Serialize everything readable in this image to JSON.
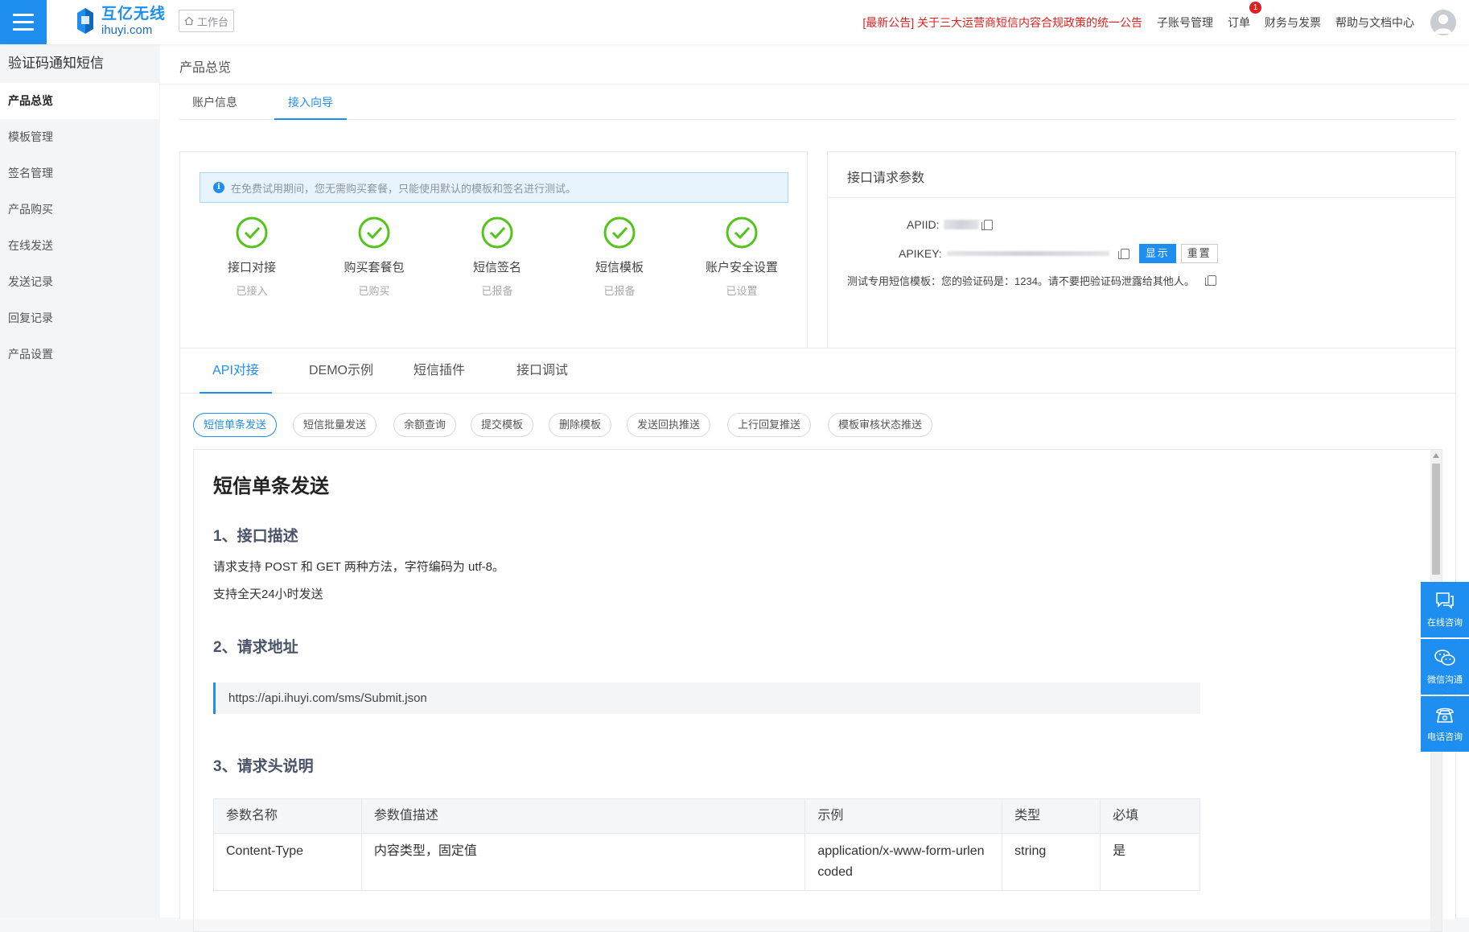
{
  "topbar": {
    "logo_cn": "互亿无线",
    "logo_en": "ihuyi.com",
    "workbench": "工作台",
    "notice": "[最新公告] 关于三大运营商短信内容合规政策的统一公告",
    "links": {
      "sub_account": "子账号管理",
      "orders": "订单",
      "orders_badge": "1",
      "finance": "财务与发票",
      "help": "帮助与文档中心"
    }
  },
  "sidebar": {
    "title": "验证码通知短信",
    "items": [
      {
        "label": "产品总览",
        "active": true
      },
      {
        "label": "模板管理"
      },
      {
        "label": "签名管理"
      },
      {
        "label": "产品购买"
      },
      {
        "label": "在线发送"
      },
      {
        "label": "发送记录"
      },
      {
        "label": "回复记录"
      },
      {
        "label": "产品设置"
      }
    ]
  },
  "main": {
    "breadcrumb": "产品总览",
    "subtabs": [
      "账户信息",
      "接入向导"
    ],
    "active_subtab": "接入向导"
  },
  "status_card": {
    "info": "在免费试用期间，您无需购买套餐，只能使用默认的模板和签名进行测试。",
    "steps": [
      {
        "title": "接口对接",
        "status": "已接入"
      },
      {
        "title": "购买套餐包",
        "status": "已购买"
      },
      {
        "title": "短信签名",
        "status": "已报备"
      },
      {
        "title": "短信模板",
        "status": "已报备"
      },
      {
        "title": "账户安全设置",
        "status": "已设置"
      }
    ]
  },
  "params_card": {
    "title": "接口请求参数",
    "apiid_label": "APIID:",
    "apikey_label": "APIKEY:",
    "show_button": "显示",
    "reset_button": "重置",
    "template_text": "测试专用短信模板：您的验证码是：1234。请不要把验证码泄露给其他人。"
  },
  "api_section": {
    "tabs": [
      "API对接",
      "DEMO示例",
      "短信插件",
      "接口调试"
    ],
    "active_tab": "API对接",
    "pills": [
      "短信单条发送",
      "短信批量发送",
      "余额查询",
      "提交模板",
      "删除模板",
      "发送回执推送",
      "上行回复推送",
      "模板审核状态推送"
    ],
    "active_pill": "短信单条发送",
    "doc": {
      "title": "短信单条发送",
      "h_desc": "1、接口描述",
      "desc_1": "请求支持 POST 和 GET 两种方法，字符编码为 utf-8。",
      "desc_2": "支持全天24小时发送",
      "h_url": "2、请求地址",
      "url": "https://api.ihuyi.com/sms/Submit.json",
      "h_header": "3、请求头说明",
      "table": {
        "headers": [
          "参数名称",
          "参数值描述",
          "示例",
          "类型",
          "必填"
        ],
        "rows": [
          [
            "Content-Type",
            "内容类型，固定值",
            "application/x-www-form-urlencoded",
            "string",
            "是"
          ]
        ]
      }
    }
  },
  "float": {
    "online": "在线咨询",
    "wechat": "微信沟通",
    "phone": "电话咨询"
  },
  "colors": {
    "primary": "#1e8ff0",
    "success": "#52c41a",
    "notice": "#e0201e"
  }
}
